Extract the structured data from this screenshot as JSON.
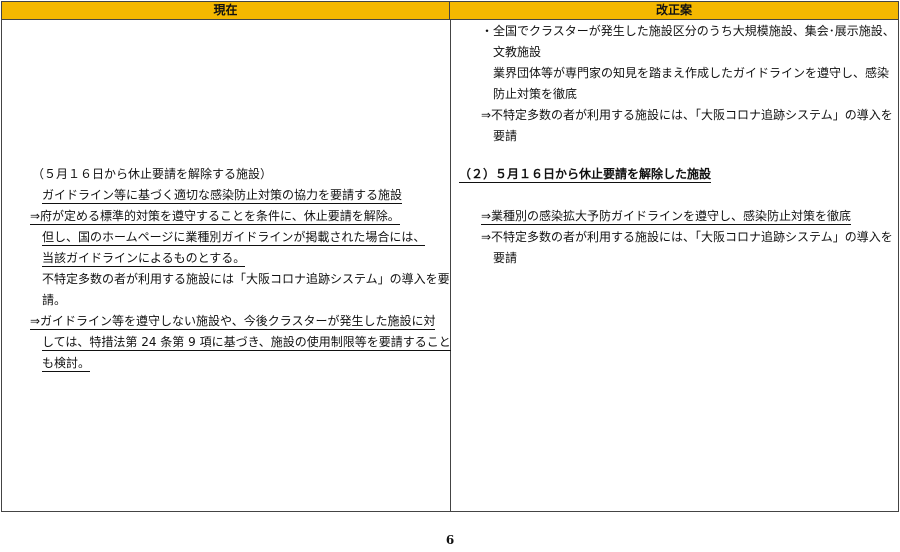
{
  "table": {
    "header_current": "現在",
    "header_revised": "改正案"
  },
  "current": {
    "lines": [
      "（５月１６日から休止要請を解除する施設）",
      "ガイドライン等に基づく適切な感染防止対策の協力を要請する施設",
      "⇒府が定める標準的対策を遵守することを条件に、休止要請を解除。",
      "但し、国のホームページに業種別ガイドラインが掲載された場合には、",
      "当該ガイドラインによるものとする。",
      "不特定多数の者が利用する施設には「大阪コロナ追跡システム」の導入を要",
      "請。",
      "⇒ガイドライン等を遵守しない施設や、今後クラスターが発生した施設に対",
      "しては、特措法第 24 条第 9 項に基づき、施設の使用制限等を要請すること",
      "も検討。"
    ]
  },
  "revised": {
    "lines": [
      "・全国でクラスターが発生した施設区分のうち大規模施設、集会･展示施設、",
      "文教施設",
      "業界団体等が専門家の知見を踏まえ作成したガイドラインを遵守し、感染",
      "防止対策を徹底",
      "⇒不特定多数の者が利用する施設には、「大阪コロナ追跡システム」の導入を",
      "要請",
      "（２）５月１６日から休止要請を解除した施設",
      "⇒業種別の感染拡大予防ガイドラインを遵守し、感染防止対策を徹底",
      "⇒不特定多数の者が利用する施設には、「大阪コロナ追跡システム」の導入を",
      "要請"
    ]
  },
  "footer": {
    "page_number": "6"
  }
}
